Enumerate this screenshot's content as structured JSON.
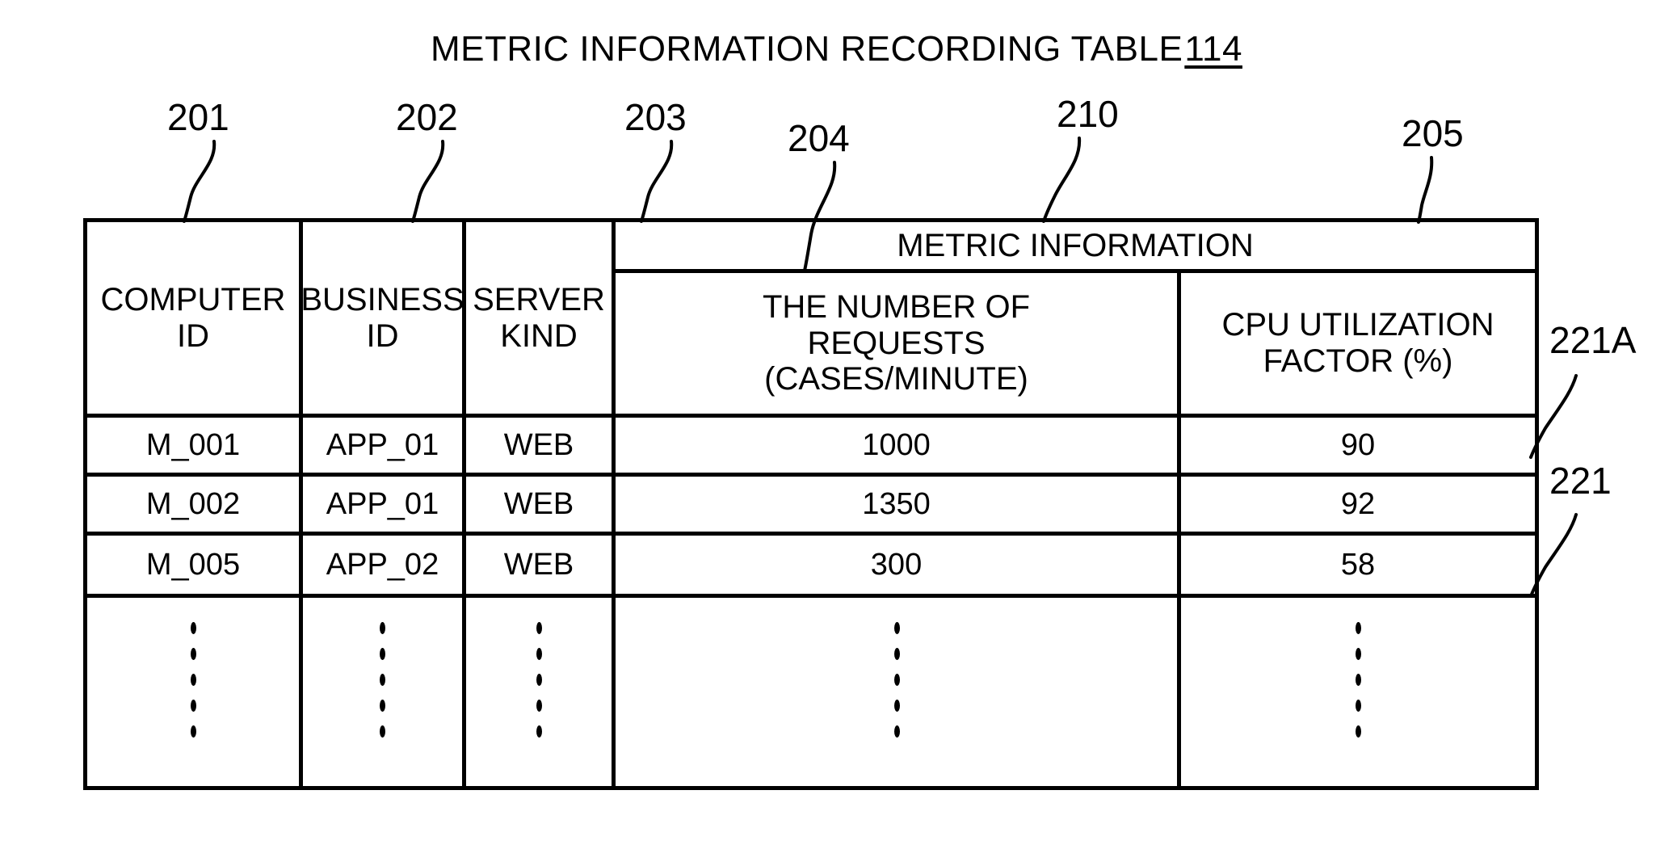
{
  "figure": {
    "title": "METRIC INFORMATION RECORDING TABLE",
    "title_ref": "114"
  },
  "callouts": {
    "col_computer_id": "201",
    "col_business_id": "202",
    "col_server_kind": "203",
    "col_number_of_requests": "204",
    "group_metric_information": "210",
    "col_cpu_utilization": "205",
    "row_first_record": "221A",
    "row_records": "221"
  },
  "table": {
    "group_header": "METRIC INFORMATION",
    "columns": [
      {
        "label": "COMPUTER\nID",
        "lines": [
          "COMPUTER",
          "ID"
        ]
      },
      {
        "label": "BUSINESS\nID",
        "lines": [
          "BUSINESS",
          "ID"
        ]
      },
      {
        "label": "SERVER\nKIND",
        "lines": [
          "SERVER",
          "KIND"
        ]
      },
      {
        "label": "THE NUMBER OF REQUESTS (CASES/MINUTE)",
        "lines": [
          "THE NUMBER OF",
          "REQUESTS",
          "(CASES/MINUTE)"
        ]
      },
      {
        "label": "CPU UTILIZATION FACTOR (%)",
        "lines": [
          "CPU UTILIZATION",
          "FACTOR (%)"
        ]
      }
    ],
    "header_col1_line1": "COMPUTER",
    "header_col1_line2": "ID",
    "header_col2_line1": "BUSINESS",
    "header_col2_line2": "ID",
    "header_col3_line1": "SERVER",
    "header_col3_line2": "KIND",
    "header_col4_line1": "THE NUMBER OF",
    "header_col4_line2": "REQUESTS",
    "header_col4_line3": "(CASES/MINUTE)",
    "header_col5_line1": "CPU UTILIZATION",
    "header_col5_line2": "FACTOR (%)",
    "rows": [
      {
        "computer_id": "M_001",
        "business_id": "APP_01",
        "server_kind": "WEB",
        "number_of_requests": "1000",
        "cpu_utilization_factor": "90"
      },
      {
        "computer_id": "M_002",
        "business_id": "APP_01",
        "server_kind": "WEB",
        "number_of_requests": "1350",
        "cpu_utilization_factor": "92"
      },
      {
        "computer_id": "M_005",
        "business_id": "APP_02",
        "server_kind": "WEB",
        "number_of_requests": "300",
        "cpu_utilization_factor": "58"
      }
    ],
    "continuation_indicator": "vertical-ellipsis"
  },
  "colors": {
    "ink": "#000000",
    "paper": "#ffffff"
  }
}
